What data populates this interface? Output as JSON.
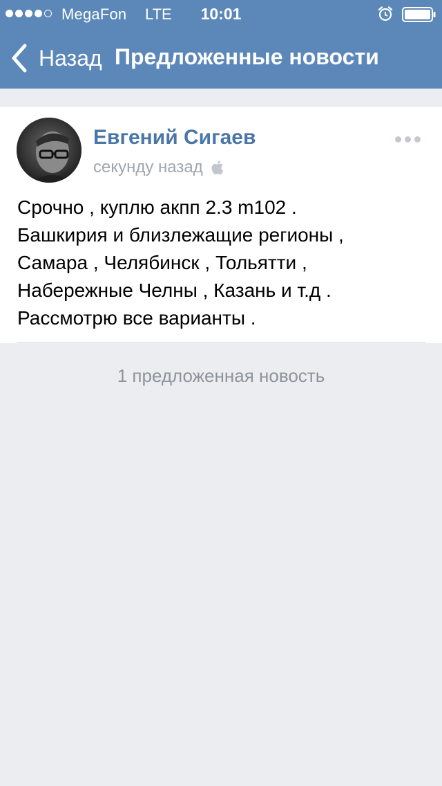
{
  "status_bar": {
    "carrier": "MegaFon",
    "network": "LTE",
    "time": "10:01",
    "signal_strength": 4,
    "signal_max": 5,
    "icons": [
      "alarm-icon",
      "battery-icon"
    ]
  },
  "nav": {
    "back_label": "Назад",
    "title": "Предложенные новости",
    "background_color": "#5b88b8"
  },
  "post": {
    "author": "Евгений Сигаев",
    "time": "секунду назад",
    "platform_icon": "apple-icon",
    "text": "Срочно , куплю акпп 2.3 m102 .\nБашкирия и близлежащие регионы ,\nСамара , Челябинск , Тольятти ,\nНабережные Челны , Казань и т.д .\nРассмотрю все варианты .",
    "author_color": "#4a76a8"
  },
  "footer": {
    "count_label": "1 предложенная новость"
  }
}
